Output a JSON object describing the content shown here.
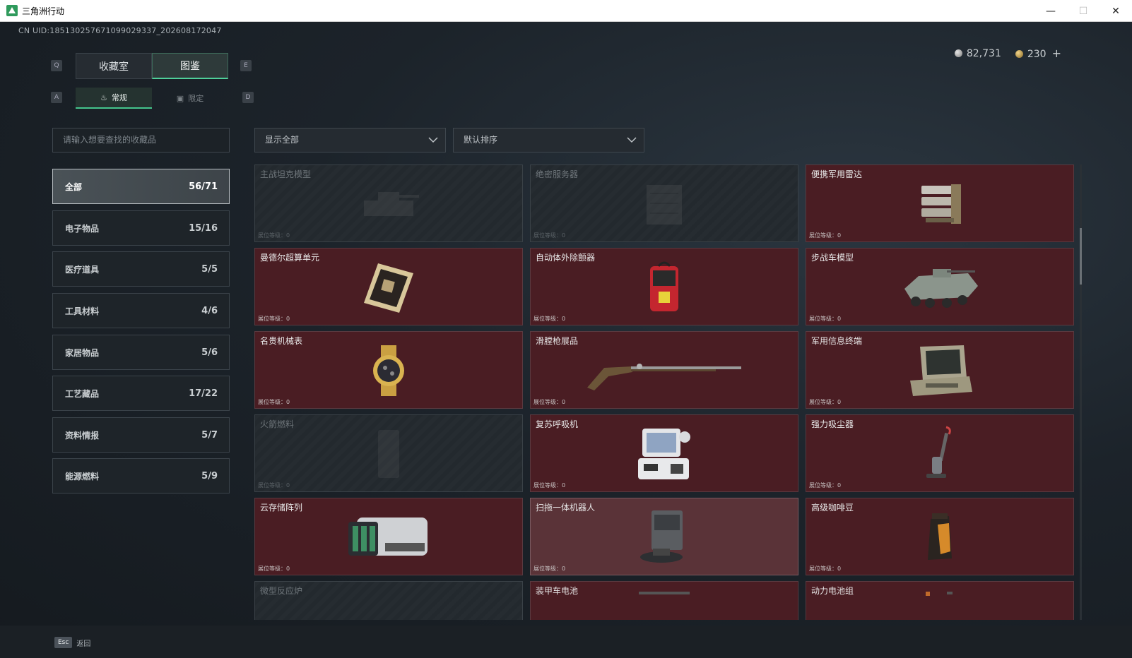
{
  "window": {
    "title": "三角洲行动"
  },
  "header": {
    "uid": "CN UID:1851302576710990293​37_202608172047",
    "silver": "82,731",
    "gold": "230",
    "plus": "+"
  },
  "hints": {
    "q": "Q",
    "e": "E",
    "a": "A",
    "d": "D"
  },
  "main_tabs": [
    {
      "label": "收藏室"
    },
    {
      "label": "图鉴"
    }
  ],
  "sub_tabs": [
    {
      "label": "常规"
    },
    {
      "label": "限定"
    }
  ],
  "search": {
    "placeholder": "请输入想要查找的收藏品"
  },
  "filters": {
    "show": "显示全部",
    "sort": "默认排序"
  },
  "categories": [
    {
      "label": "全部",
      "count": "56/71"
    },
    {
      "label": "电子物品",
      "count": "15/16"
    },
    {
      "label": "医疗道具",
      "count": "5/5"
    },
    {
      "label": "工具材料",
      "count": "4/6"
    },
    {
      "label": "家居物品",
      "count": "5/6"
    },
    {
      "label": "工艺藏品",
      "count": "17/22"
    },
    {
      "label": "资料情报",
      "count": "5/7"
    },
    {
      "label": "能源燃料",
      "count": "5/9"
    }
  ],
  "level_label": "展位等级：0",
  "items": [
    {
      "name": "主战坦克模型",
      "state": "locked",
      "icon": "tank-model-icon"
    },
    {
      "name": "绝密服务器",
      "state": "locked",
      "icon": "server-icon"
    },
    {
      "name": "便携军用雷达",
      "state": "unlocked",
      "icon": "radar-icon"
    },
    {
      "name": "曼德尔超算单元",
      "state": "unlocked",
      "icon": "supercomputer-unit-icon"
    },
    {
      "name": "自动体外除颤器",
      "state": "unlocked",
      "icon": "defibrillator-icon"
    },
    {
      "name": "步战车模型",
      "state": "unlocked",
      "icon": "ifv-model-icon"
    },
    {
      "name": "名贵机械表",
      "state": "unlocked",
      "icon": "watch-icon"
    },
    {
      "name": "滑膛枪展品",
      "state": "unlocked",
      "icon": "musket-icon"
    },
    {
      "name": "军用信息终端",
      "state": "unlocked",
      "icon": "terminal-icon"
    },
    {
      "name": "火箭燃料",
      "state": "locked",
      "icon": "rocket-fuel-icon"
    },
    {
      "name": "复苏呼吸机",
      "state": "unlocked",
      "icon": "ventilator-icon"
    },
    {
      "name": "强力吸尘器",
      "state": "unlocked",
      "icon": "vacuum-icon"
    },
    {
      "name": "云存储阵列",
      "state": "unlocked",
      "icon": "storage-array-icon"
    },
    {
      "name": "扫拖一体机器人",
      "state": "highlight",
      "icon": "robot-vacuum-icon"
    },
    {
      "name": "高级咖啡豆",
      "state": "unlocked",
      "icon": "coffee-bag-icon"
    },
    {
      "name": "微型反应炉",
      "state": "locked",
      "icon": "reactor-icon"
    },
    {
      "name": "装甲车电池",
      "state": "unlocked",
      "icon": "battery-icon"
    },
    {
      "name": "动力电池组",
      "state": "unlocked",
      "icon": "battery-pack-icon"
    }
  ],
  "footer": {
    "esc_key": "Esc",
    "back": "返回"
  },
  "colors": {
    "accent": "#4fd09a",
    "card_red": "#4a1d23",
    "card_highlight": "#5a3338"
  }
}
